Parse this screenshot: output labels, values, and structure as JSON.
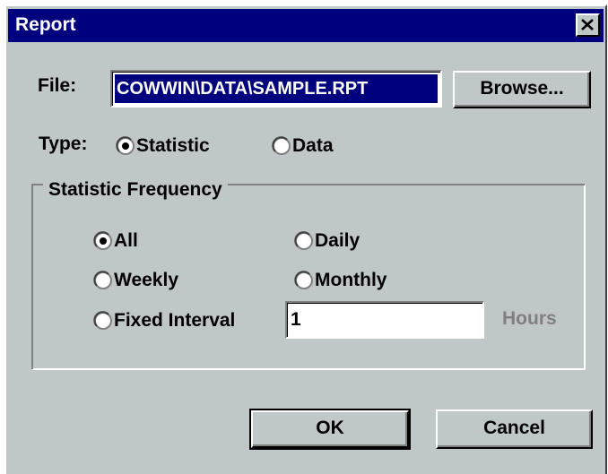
{
  "window": {
    "title": "Report"
  },
  "file": {
    "label": "File:",
    "value": "COWWIN\\DATA\\SAMPLE.RPT",
    "browse_label": "Browse..."
  },
  "type": {
    "label": "Type:",
    "options": [
      {
        "label": "Statistic",
        "selected": true
      },
      {
        "label": "Data",
        "selected": false
      }
    ]
  },
  "frequency": {
    "title": "Statistic Frequency",
    "options": [
      {
        "label": "All",
        "selected": true
      },
      {
        "label": "Daily",
        "selected": false
      },
      {
        "label": "Weekly",
        "selected": false
      },
      {
        "label": "Monthly",
        "selected": false
      },
      {
        "label": "Fixed Interval",
        "selected": false
      }
    ],
    "interval_value": "1",
    "interval_unit": "Hours"
  },
  "buttons": {
    "ok": "OK",
    "cancel": "Cancel"
  },
  "icons": {
    "close": "close-icon",
    "radio": "radio-icon"
  },
  "colors": {
    "face": "#c0c7c8",
    "title_bar": "#00007e",
    "selection": "#00007e",
    "disabled_text": "#808080"
  }
}
